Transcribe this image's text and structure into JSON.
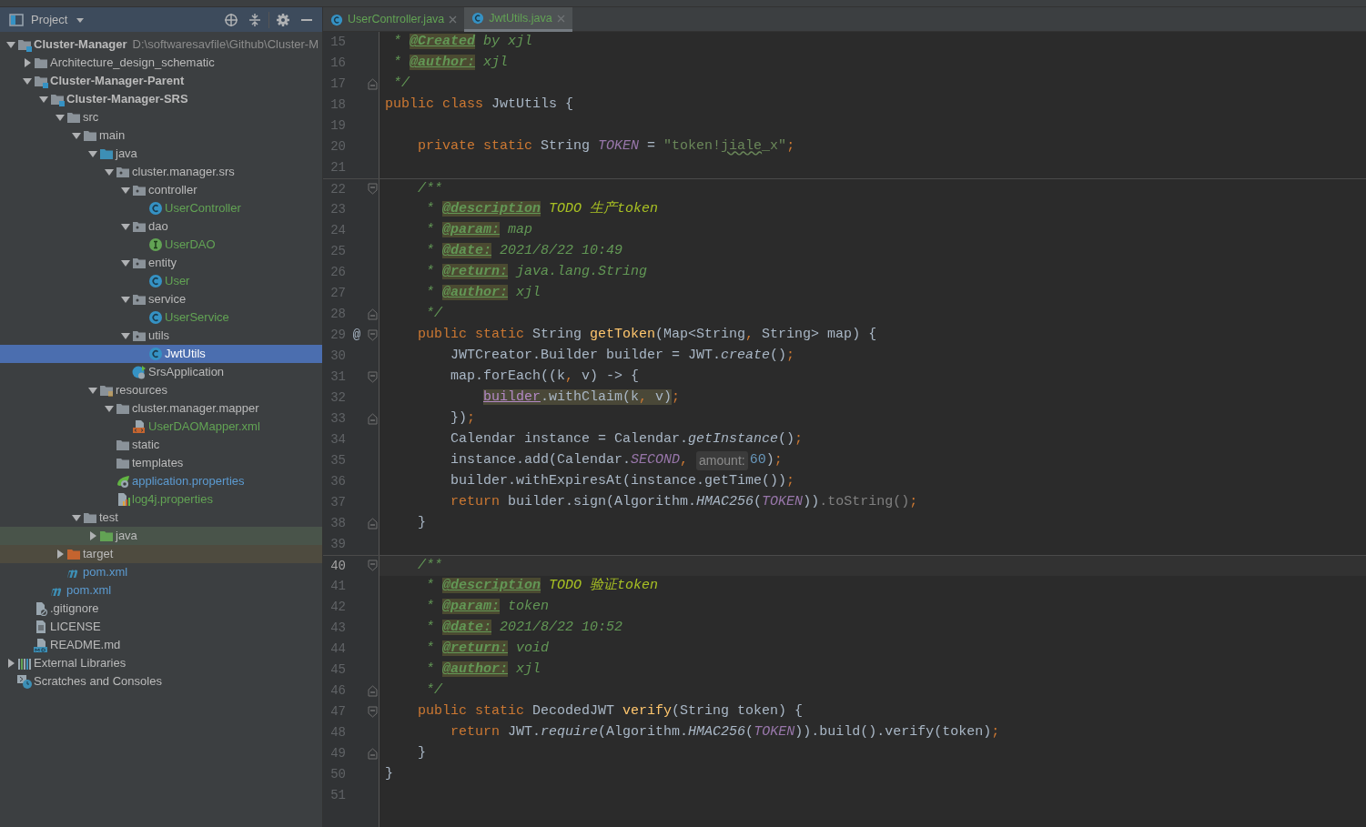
{
  "project_panel": {
    "title": "Project",
    "tree": [
      {
        "label": "Cluster-Manager",
        "kind": "module",
        "path": "D:\\softwaresavfile\\Github\\Cluster-M",
        "expanded": true,
        "selected": false,
        "children": [
          {
            "label": "Architecture_design_schematic",
            "kind": "folder",
            "expanded": false,
            "selected": false
          },
          {
            "label": "Cluster-Manager-Parent",
            "kind": "module",
            "expanded": true,
            "selected": false,
            "children": [
              {
                "label": "Cluster-Manager-SRS",
                "kind": "module",
                "expanded": true,
                "selected": false,
                "children": [
                  {
                    "label": "src",
                    "kind": "folder",
                    "expanded": true,
                    "selected": false,
                    "children": [
                      {
                        "label": "main",
                        "kind": "folder",
                        "expanded": true,
                        "selected": false,
                        "children": [
                          {
                            "label": "java",
                            "kind": "source",
                            "expanded": true,
                            "selected": false,
                            "children": [
                              {
                                "label": "cluster.manager.srs",
                                "kind": "package",
                                "expanded": true,
                                "selected": false,
                                "children": [
                                  {
                                    "label": "controller",
                                    "kind": "package",
                                    "expanded": true,
                                    "selected": false,
                                    "children": [
                                      {
                                        "label": "UserController",
                                        "kind": "class",
                                        "color": "#62a354",
                                        "selected": false
                                      }
                                    ]
                                  },
                                  {
                                    "label": "dao",
                                    "kind": "package",
                                    "expanded": true,
                                    "selected": false,
                                    "children": [
                                      {
                                        "label": "UserDAO",
                                        "kind": "interface",
                                        "color": "#62a354",
                                        "selected": false
                                      }
                                    ]
                                  },
                                  {
                                    "label": "entity",
                                    "kind": "package",
                                    "expanded": true,
                                    "selected": false,
                                    "children": [
                                      {
                                        "label": "User",
                                        "kind": "class",
                                        "color": "#62a354",
                                        "selected": false
                                      }
                                    ]
                                  },
                                  {
                                    "label": "service",
                                    "kind": "package",
                                    "expanded": true,
                                    "selected": false,
                                    "children": [
                                      {
                                        "label": "UserService",
                                        "kind": "class",
                                        "color": "#62a354",
                                        "selected": false
                                      }
                                    ]
                                  },
                                  {
                                    "label": "utils",
                                    "kind": "package",
                                    "expanded": true,
                                    "selected": false,
                                    "children": [
                                      {
                                        "label": "JwtUtils",
                                        "kind": "class",
                                        "selected": true
                                      }
                                    ]
                                  },
                                  {
                                    "label": "SrsApplication",
                                    "kind": "spring-class",
                                    "selected": false
                                  }
                                ]
                              }
                            ]
                          },
                          {
                            "label": "resources",
                            "kind": "resources",
                            "expanded": true,
                            "selected": false,
                            "children": [
                              {
                                "label": "cluster.manager.mapper",
                                "kind": "folder",
                                "expanded": true,
                                "selected": false,
                                "children": [
                                  {
                                    "label": "UserDAOMapper.xml",
                                    "kind": "xml",
                                    "color": "#62a354",
                                    "selected": false
                                  }
                                ]
                              },
                              {
                                "label": "static",
                                "kind": "folder",
                                "selected": false
                              },
                              {
                                "label": "templates",
                                "kind": "folder",
                                "selected": false
                              },
                              {
                                "label": "application.properties",
                                "kind": "spring-properties",
                                "color": "#5c9bd1",
                                "selected": false
                              },
                              {
                                "label": "log4j.properties",
                                "kind": "properties",
                                "color": "#62a354",
                                "selected": false
                              }
                            ]
                          }
                        ]
                      },
                      {
                        "label": "test",
                        "kind": "folder",
                        "expanded": true,
                        "selected": false,
                        "children": [
                          {
                            "label": "java",
                            "kind": "test-source",
                            "expanded": false,
                            "test_scope": true,
                            "selected": false
                          }
                        ]
                      }
                    ]
                  },
                  {
                    "label": "target",
                    "kind": "excluded",
                    "expanded": false,
                    "excluded": true,
                    "selected": false
                  },
                  {
                    "label": "pom.xml",
                    "kind": "maven",
                    "color": "#5c9bd1",
                    "selected": false
                  }
                ]
              },
              {
                "label": "pom.xml",
                "kind": "maven",
                "color": "#5c9bd1",
                "selected": false
              }
            ]
          },
          {
            "label": ".gitignore",
            "kind": "ignore-file",
            "selected": false
          },
          {
            "label": "LICENSE",
            "kind": "text-file",
            "selected": false
          },
          {
            "label": "README.md",
            "kind": "markdown",
            "selected": false
          }
        ]
      },
      {
        "label": "External Libraries",
        "kind": "libraries",
        "expanded": false,
        "selected": false
      },
      {
        "label": "Scratches and Consoles",
        "kind": "scratches",
        "selected": false
      }
    ]
  },
  "editor": {
    "tabs": [
      {
        "label": "UserController.java",
        "selected": false
      },
      {
        "label": "JwtUtils.java",
        "selected": true
      }
    ],
    "lines": [
      {
        "number": "15",
        "code": [
          {
            "text": " * ",
            "kind": "doc"
          },
          {
            "text": "@Created",
            "kind": "tag"
          },
          {
            "text": " by xjl",
            "kind": "doc"
          }
        ]
      },
      {
        "number": "16",
        "code": [
          {
            "text": " * ",
            "kind": "doc"
          },
          {
            "text": "@author:",
            "kind": "tag"
          },
          {
            "text": " xjl",
            "kind": "doc"
          }
        ]
      },
      {
        "number": "17",
        "fold_end": true,
        "code": [
          {
            "text": " */",
            "kind": "doc"
          }
        ]
      },
      {
        "number": "18",
        "code": [
          {
            "text": "public class ",
            "kind": "kw"
          },
          {
            "text": "JwtUtils {",
            "kind": "p"
          }
        ]
      },
      {
        "number": "19"
      },
      {
        "number": "20",
        "code": [
          {
            "text": "    private static ",
            "kind": "kw"
          },
          {
            "text": "String ",
            "kind": "p"
          },
          {
            "text": "TOKEN",
            "kind": "const"
          },
          {
            "text": " = ",
            "kind": "p"
          },
          {
            "text": "\"token!",
            "kind": "str"
          },
          {
            "text": "jiale",
            "kind": "typo"
          },
          {
            "text": "_x\"",
            "kind": "str"
          },
          {
            "text": ";",
            "kind": "punct"
          }
        ]
      },
      {
        "number": "21"
      },
      {
        "number": "22",
        "separator": true,
        "fold_start": true,
        "code": [
          {
            "text": "    /**",
            "kind": "doc"
          }
        ]
      },
      {
        "number": "23",
        "code": [
          {
            "text": "     * ",
            "kind": "doc"
          },
          {
            "text": "@description",
            "kind": "tag"
          },
          {
            "text": " TODO 生产token",
            "kind": "todo"
          }
        ]
      },
      {
        "number": "24",
        "code": [
          {
            "text": "     * ",
            "kind": "doc"
          },
          {
            "text": "@param:",
            "kind": "tag"
          },
          {
            "text": " map",
            "kind": "doc"
          }
        ]
      },
      {
        "number": "25",
        "code": [
          {
            "text": "     * ",
            "kind": "doc"
          },
          {
            "text": "@date:",
            "kind": "tag"
          },
          {
            "text": " 2021/8/22 10:49",
            "kind": "doc"
          }
        ]
      },
      {
        "number": "26",
        "code": [
          {
            "text": "     * ",
            "kind": "doc"
          },
          {
            "text": "@return:",
            "kind": "tag"
          },
          {
            "text": " java.lang.String",
            "kind": "doc"
          }
        ]
      },
      {
        "number": "27",
        "code": [
          {
            "text": "     * ",
            "kind": "doc"
          },
          {
            "text": "@author:",
            "kind": "tag"
          },
          {
            "text": " xjl",
            "kind": "doc"
          }
        ]
      },
      {
        "number": "28",
        "fold_end": true,
        "code": [
          {
            "text": "     */",
            "kind": "doc"
          }
        ]
      },
      {
        "number": "29",
        "gutter": "@",
        "fold_start": true,
        "code": [
          {
            "text": "    public static ",
            "kind": "kw"
          },
          {
            "text": "String ",
            "kind": "p"
          },
          {
            "text": "getToken",
            "kind": "decl"
          },
          {
            "text": "(Map<String",
            "kind": "p"
          },
          {
            "text": ", ",
            "kind": "punct"
          },
          {
            "text": "String> map) {",
            "kind": "p"
          }
        ]
      },
      {
        "number": "30",
        "code": [
          {
            "text": "        JWTCreator.Builder builder = JWT.",
            "kind": "p"
          },
          {
            "text": "create",
            "kind": "sc"
          },
          {
            "text": "()",
            "kind": "p"
          },
          {
            "text": ";",
            "kind": "punct"
          }
        ]
      },
      {
        "number": "31",
        "fold_start": true,
        "code": [
          {
            "text": "        map.forEach((k",
            "kind": "p"
          },
          {
            "text": ", ",
            "kind": "punct"
          },
          {
            "text": "v) -> {",
            "kind": "p"
          }
        ]
      },
      {
        "number": "32",
        "code": [
          {
            "text": "            builder",
            "kind": "hlv"
          },
          {
            "text": ".withClaim(k",
            "kind": "hlp"
          },
          {
            "text": ", ",
            "kind": "hlpunct"
          },
          {
            "text": "v)",
            "kind": "hlp"
          },
          {
            "text": ";",
            "kind": "punct"
          }
        ]
      },
      {
        "number": "33",
        "fold_end": true,
        "code": [
          {
            "text": "        })",
            "kind": "p"
          },
          {
            "text": ";",
            "kind": "punct"
          }
        ]
      },
      {
        "number": "34",
        "code": [
          {
            "text": "        Calendar instance = Calendar.",
            "kind": "p"
          },
          {
            "text": "getInstance",
            "kind": "sc"
          },
          {
            "text": "()",
            "kind": "p"
          },
          {
            "text": ";",
            "kind": "punct"
          }
        ]
      },
      {
        "number": "35",
        "code": [
          {
            "text": "        instance.add(Calendar.",
            "kind": "p"
          },
          {
            "text": "SECOND",
            "kind": "const"
          },
          {
            "text": ", ",
            "kind": "punct"
          },
          {
            "text": "amount:",
            "kind": "hint"
          },
          {
            "text": "60",
            "kind": "num"
          },
          {
            "text": ")",
            "kind": "p"
          },
          {
            "text": ";",
            "kind": "punct"
          }
        ]
      },
      {
        "number": "36",
        "code": [
          {
            "text": "        builder.withExpiresAt(instance.getTime())",
            "kind": "p"
          },
          {
            "text": ";",
            "kind": "punct"
          }
        ]
      },
      {
        "number": "37",
        "code": [
          {
            "text": "        return ",
            "kind": "kw"
          },
          {
            "text": "builder.sign(Algorithm.",
            "kind": "p"
          },
          {
            "text": "HMAC256",
            "kind": "sc"
          },
          {
            "text": "(",
            "kind": "p"
          },
          {
            "text": "TOKEN",
            "kind": "const"
          },
          {
            "text": "))",
            "kind": "p"
          },
          {
            "text": ".toString()",
            "kind": "gray"
          },
          {
            "text": ";",
            "kind": "punct"
          }
        ]
      },
      {
        "number": "38",
        "fold_end": true,
        "code": [
          {
            "text": "    }",
            "kind": "p"
          }
        ]
      },
      {
        "number": "39"
      },
      {
        "number": "40",
        "separator": true,
        "current": true,
        "fold_start": true,
        "code": [
          {
            "text": "    /**",
            "kind": "doc"
          }
        ]
      },
      {
        "number": "41",
        "code": [
          {
            "text": "     * ",
            "kind": "doc"
          },
          {
            "text": "@description",
            "kind": "tag"
          },
          {
            "text": " TODO 验证token",
            "kind": "todo"
          }
        ]
      },
      {
        "number": "42",
        "code": [
          {
            "text": "     * ",
            "kind": "doc"
          },
          {
            "text": "@param:",
            "kind": "tag"
          },
          {
            "text": " token",
            "kind": "doc"
          }
        ]
      },
      {
        "number": "43",
        "code": [
          {
            "text": "     * ",
            "kind": "doc"
          },
          {
            "text": "@date:",
            "kind": "tag"
          },
          {
            "text": " 2021/8/22 10:52",
            "kind": "doc"
          }
        ]
      },
      {
        "number": "44",
        "code": [
          {
            "text": "     * ",
            "kind": "doc"
          },
          {
            "text": "@return:",
            "kind": "tag"
          },
          {
            "text": " void",
            "kind": "doc"
          }
        ]
      },
      {
        "number": "45",
        "code": [
          {
            "text": "     * ",
            "kind": "doc"
          },
          {
            "text": "@author:",
            "kind": "tag"
          },
          {
            "text": " xjl",
            "kind": "doc"
          }
        ]
      },
      {
        "number": "46",
        "fold_end": true,
        "code": [
          {
            "text": "     */",
            "kind": "doc"
          }
        ]
      },
      {
        "number": "47",
        "fold_start": true,
        "code": [
          {
            "text": "    public static ",
            "kind": "kw"
          },
          {
            "text": "DecodedJWT ",
            "kind": "p"
          },
          {
            "text": "verify",
            "kind": "decl"
          },
          {
            "text": "(String token) {",
            "kind": "p"
          }
        ]
      },
      {
        "number": "48",
        "code": [
          {
            "text": "        return ",
            "kind": "kw"
          },
          {
            "text": "JWT.",
            "kind": "p"
          },
          {
            "text": "require",
            "kind": "sc"
          },
          {
            "text": "(Algorithm.",
            "kind": "p"
          },
          {
            "text": "HMAC256",
            "kind": "sc"
          },
          {
            "text": "(",
            "kind": "p"
          },
          {
            "text": "TOKEN",
            "kind": "const"
          },
          {
            "text": ")).build().verify(token)",
            "kind": "p"
          },
          {
            "text": ";",
            "kind": "punct"
          }
        ]
      },
      {
        "number": "49",
        "fold_end": true,
        "code": [
          {
            "text": "    }",
            "kind": "p"
          }
        ]
      },
      {
        "number": "50",
        "code": [
          {
            "text": "}",
            "kind": "p"
          }
        ]
      },
      {
        "number": "51"
      }
    ]
  }
}
